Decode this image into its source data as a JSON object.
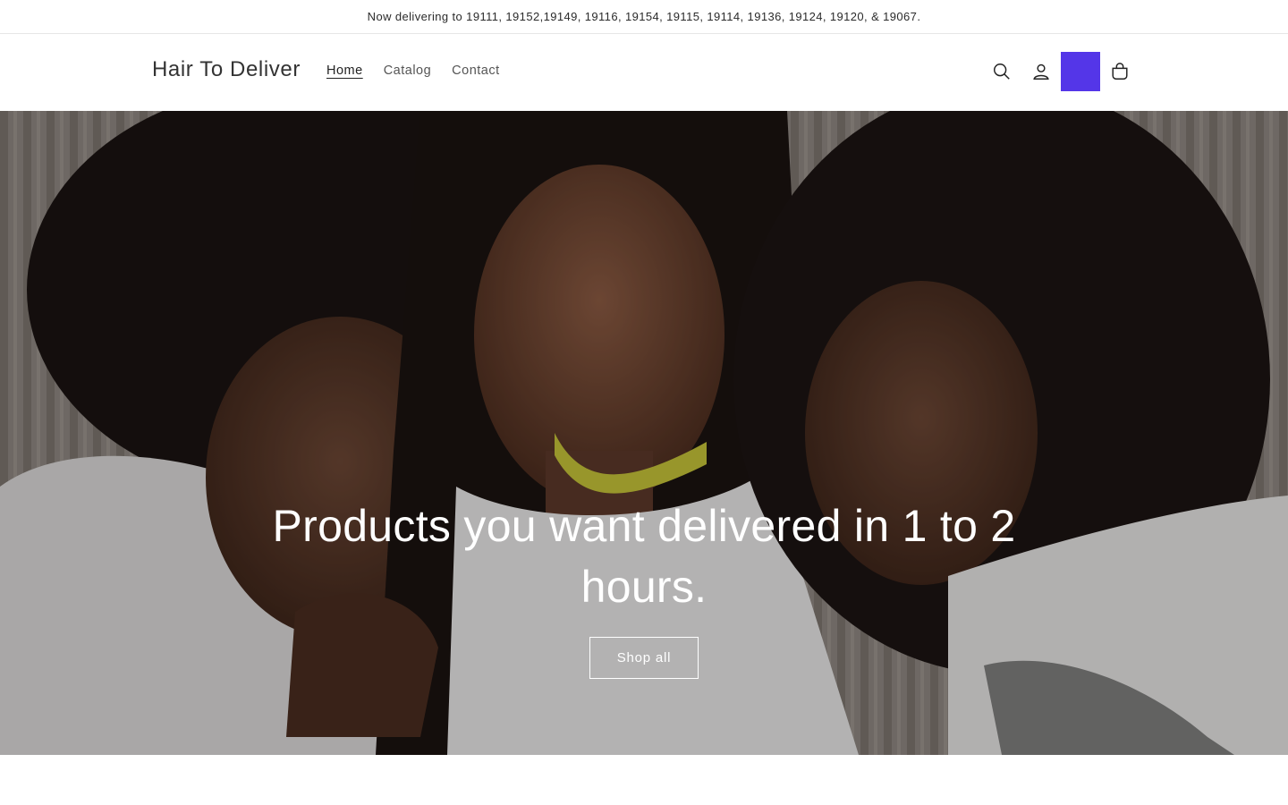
{
  "announcement": {
    "text": "Now delivering to 19111, 19152,19149, 19116, 19154, 19115, 19114, 19136, 19124, 19120, & 19067."
  },
  "header": {
    "brand": "Hair To Deliver",
    "nav": [
      {
        "label": "Home",
        "active": true
      },
      {
        "label": "Catalog",
        "active": false
      },
      {
        "label": "Contact",
        "active": false
      }
    ],
    "icons": [
      "search-icon",
      "account-icon",
      "cart-icon"
    ],
    "accent_color": "#5436e8"
  },
  "hero": {
    "title": "Products you want delivered in 1 to 2 hours.",
    "button_label": "Shop all"
  }
}
